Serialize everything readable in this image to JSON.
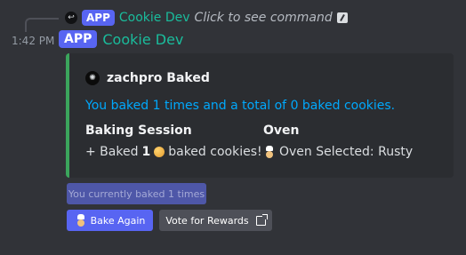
{
  "reply": {
    "app_badge": "APP",
    "name": "Cookie Dev",
    "text": "Click to see command"
  },
  "message": {
    "timestamp": "1:42 PM",
    "app_badge": "APP",
    "author": "Cookie Dev"
  },
  "embed": {
    "accent_color": "#3ba55c",
    "author_name": "zachpro Baked",
    "description": "You baked 1 times and a total of 0 baked cookies.",
    "fields": [
      {
        "name": "Baking Session",
        "value_prefix": "+ Baked",
        "value_count": "1",
        "value_suffix": "baked cookies!"
      },
      {
        "name": "Oven",
        "value": "Oven Selected: Rusty"
      }
    ]
  },
  "buttons": {
    "status_label": "You currently baked 1 times",
    "bake_again_label": "Bake Again",
    "vote_label": "Vote for Rewards"
  }
}
